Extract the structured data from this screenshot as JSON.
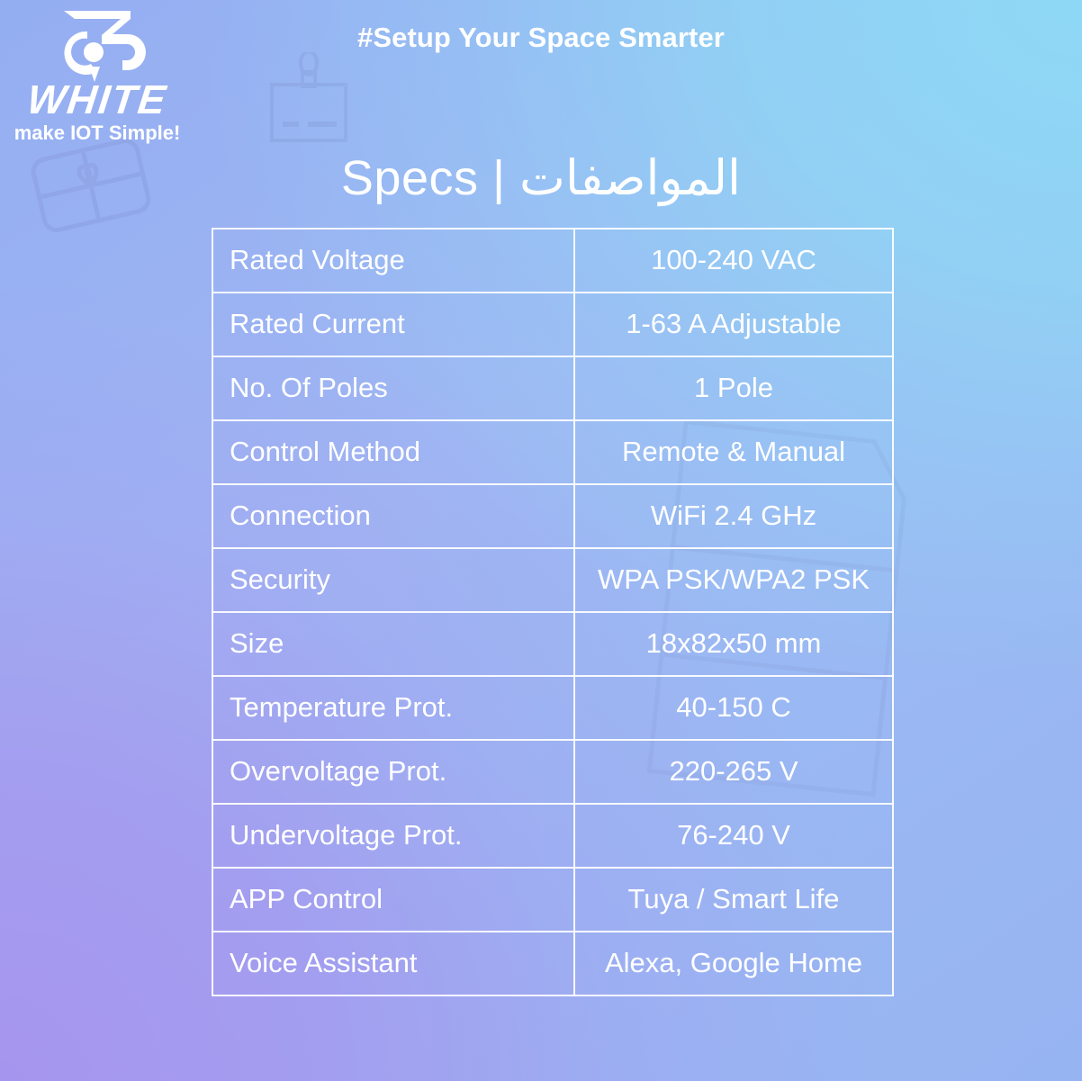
{
  "brand": {
    "logo_mark": "monogram-73-icon",
    "wordmark": "WHITE",
    "tagline": "make IOT Simple!"
  },
  "header": {
    "hashtag": "#Setup Your Space Smarter"
  },
  "title": {
    "text": "Specs | المواصفات",
    "english": "Specs",
    "arabic": "المواصفات"
  },
  "watermarks": [
    {
      "name": "gift-box-watermark"
    },
    {
      "name": "panel-device-watermark"
    },
    {
      "name": "large-outline-watermark"
    }
  ],
  "colors": {
    "gradient_top_left": "#94aef2",
    "gradient_top_right": "#8ed9f5",
    "gradient_bottom_left": "#a694ee",
    "gradient_bottom_right": "#97b4f2",
    "text": "#ffffff",
    "table_border": "#ffffff"
  },
  "specs": {
    "rows": [
      {
        "key": "Rated Voltage",
        "value": "100-240 VAC"
      },
      {
        "key": "Rated Current",
        "value": "1-63 A Adjustable"
      },
      {
        "key": "No. Of Poles",
        "value": "1 Pole"
      },
      {
        "key": "Control Method",
        "value": "Remote & Manual"
      },
      {
        "key": "Connection",
        "value": "WiFi 2.4 GHz"
      },
      {
        "key": "Security",
        "value": "WPA PSK/WPA2 PSK"
      },
      {
        "key": "Size",
        "value": "18x82x50 mm"
      },
      {
        "key": "Temperature Prot.",
        "value": "40-150 C"
      },
      {
        "key": "Overvoltage Prot.",
        "value": "220-265 V"
      },
      {
        "key": "Undervoltage Prot.",
        "value": "76-240 V"
      },
      {
        "key": "APP Control",
        "value": "Tuya / Smart Life"
      },
      {
        "key": "Voice Assistant",
        "value": "Alexa, Google Home"
      }
    ]
  }
}
